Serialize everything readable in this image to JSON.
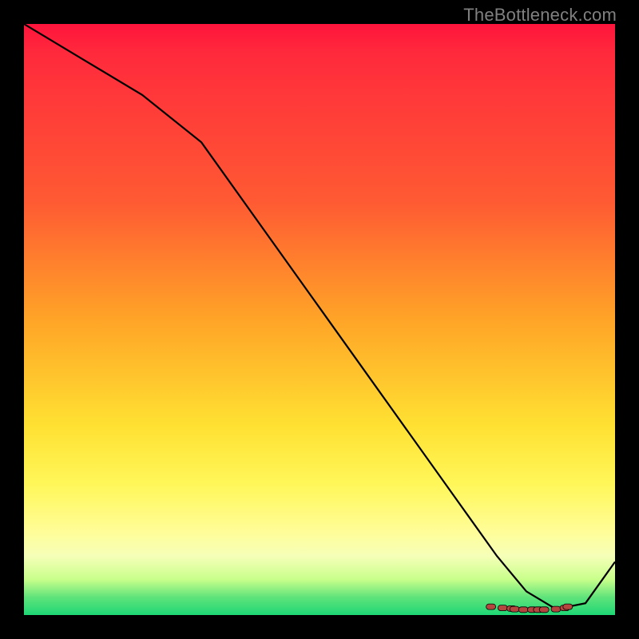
{
  "watermark": "TheBottleneck.com",
  "colors": {
    "background": "#000000",
    "curve_stroke": "#000000",
    "marker_fill": "#b5463f",
    "marker_stroke": "#000000",
    "watermark": "#808080"
  },
  "chart_data": {
    "type": "line",
    "title": "",
    "xlabel": "",
    "ylabel": "",
    "xlim": [
      0,
      100
    ],
    "ylim": [
      0,
      100
    ],
    "grid": false,
    "legend": false,
    "series": [
      {
        "name": "curve",
        "x": [
          0,
          10,
          20,
          30,
          40,
          50,
          60,
          70,
          75,
          80,
          85,
          90,
          95,
          100
        ],
        "y": [
          100,
          94,
          88,
          80,
          66,
          52,
          38,
          24,
          17,
          10,
          4,
          1,
          2,
          9
        ]
      }
    ],
    "markers": {
      "name": "flat-valley-points",
      "x": [
        79,
        81,
        82.5,
        83,
        84.5,
        86,
        87,
        88,
        90,
        91.5,
        92
      ],
      "y": [
        1.4,
        1.2,
        1.1,
        1.0,
        0.9,
        0.9,
        0.9,
        0.9,
        1.0,
        1.2,
        1.4
      ]
    },
    "annotations": []
  }
}
